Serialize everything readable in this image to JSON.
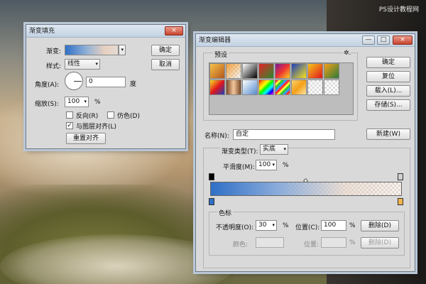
{
  "watermark": "PS设计教程网",
  "colors": {
    "accent": "#2f6fc6",
    "dialog_bg": "#d9d9d9"
  },
  "gradient_fill": {
    "title": "渐变填充",
    "gradient_label": "渐变:",
    "style_label": "样式:",
    "style_value": "线性",
    "angle_label": "角度(A):",
    "angle_value": "0",
    "angle_unit": "度",
    "scale_label": "缩放(S):",
    "scale_value": "100",
    "scale_unit": "%",
    "reverse_label": "反向(R)",
    "dither_label": "仿色(D)",
    "align_label": "与图层对齐(L)",
    "align_checked": "✓",
    "reset_align_btn": "重置对齐",
    "ok_btn": "确定",
    "cancel_btn": "取消",
    "close_glyph": "×"
  },
  "gradient_editor": {
    "title": "渐变编辑器",
    "presets_label": "预设",
    "gear_glyph": "✲.",
    "ok_btn": "确定",
    "reset_btn": "复位",
    "load_btn": "载入(L)...",
    "save_btn": "存储(S)...",
    "name_label": "名称(N):",
    "name_value": "自定",
    "new_btn": "新建(W)",
    "type_label": "渐变类型(T):",
    "type_value": "实底",
    "smooth_label": "平滑度(M):",
    "smooth_value": "100",
    "smooth_unit": "%",
    "stops_group": "色标",
    "opacity_label": "不透明度(O):",
    "opacity_value": "30",
    "opacity_unit": "%",
    "location_label": "位置(C):",
    "location_value": "100",
    "location_unit": "%",
    "delete_btn": "删除(D)",
    "color_label": "颜色:",
    "color_location_label": "位置:",
    "color_location_unit": "%",
    "color_delete_btn": "删除(D)",
    "min_glyph": "—",
    "max_glyph": "□",
    "close_glyph": "×"
  }
}
